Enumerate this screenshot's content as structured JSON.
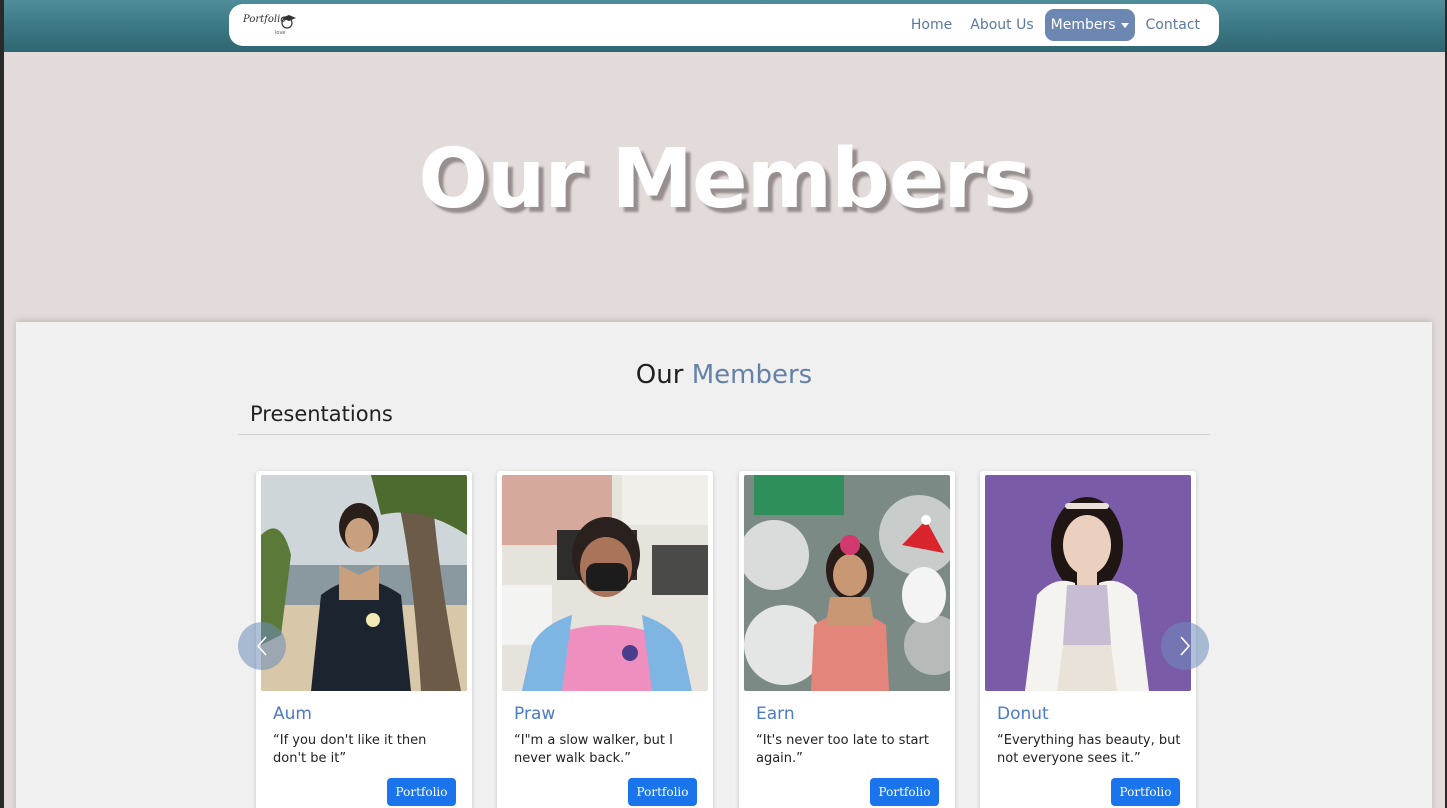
{
  "brand": {
    "name": "Portfolio",
    "sub": "love"
  },
  "nav": {
    "home": "Home",
    "about": "About Us",
    "members": "Members",
    "contact": "Contact"
  },
  "hero": {
    "title": "Our Members"
  },
  "section": {
    "title_main": "Our",
    "title_accent": "Members",
    "subtitle": "Presentations"
  },
  "cards": [
    {
      "name": "Aum",
      "quote": "“If you don't like it then don't be it”",
      "button": "Portfolio"
    },
    {
      "name": "Praw",
      "quote": "“I\"m a slow walker, but I never walk back.”",
      "button": "Portfolio"
    },
    {
      "name": "Earn",
      "quote": "“It's never too late to start again.”",
      "button": "Portfolio"
    },
    {
      "name": "Donut",
      "quote": "“Everything has beauty, but not everyone sees it.”",
      "button": "Portfolio"
    }
  ],
  "colors": {
    "topbar": "#3a7581",
    "hero_bg": "#e3dbd9",
    "accent": "#6581a8",
    "button": "#1a74ec",
    "name": "#4b7ac9"
  },
  "icons": {
    "prev": "chevron-left-icon",
    "next": "chevron-right-icon",
    "dropdown": "caret-down-icon"
  }
}
